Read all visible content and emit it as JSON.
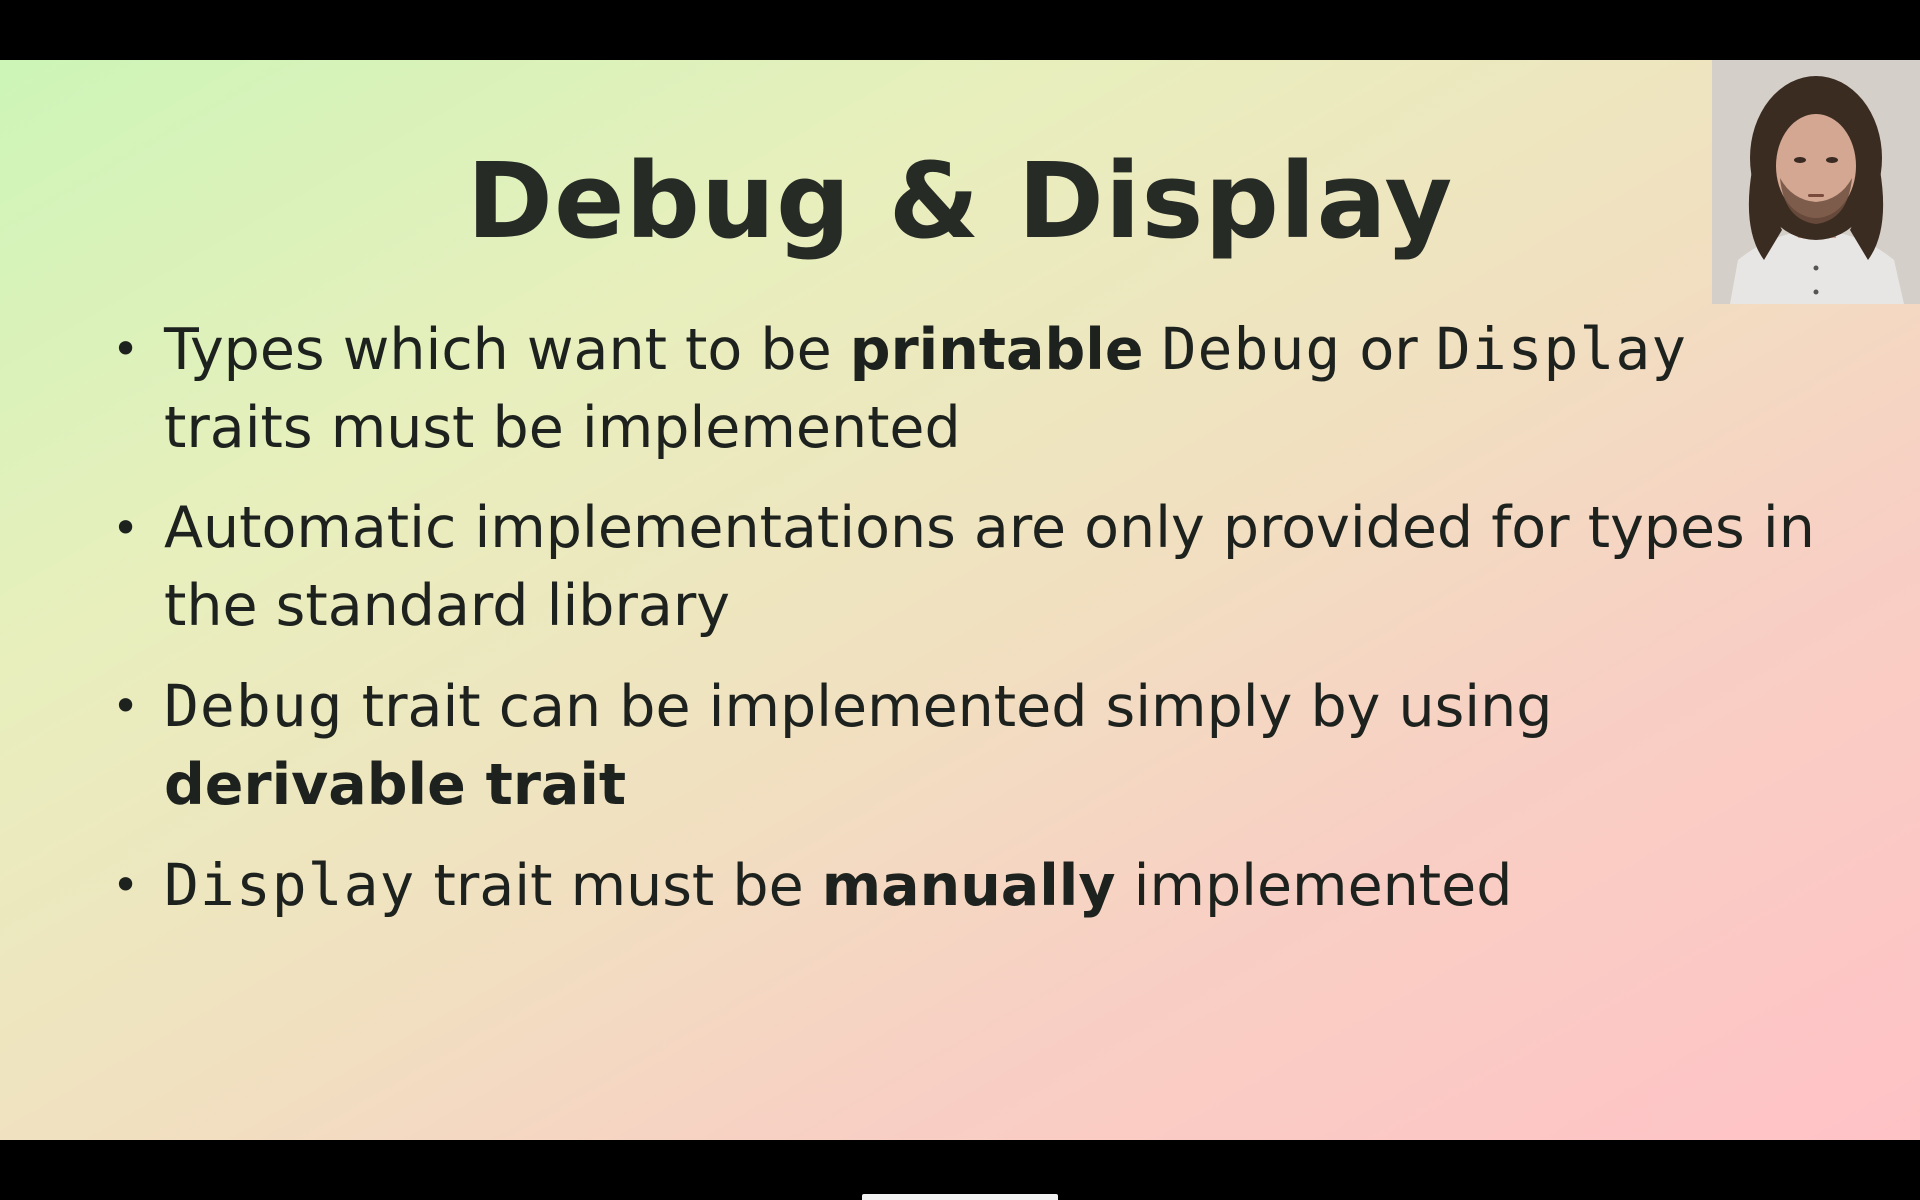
{
  "slide": {
    "title": "Debug & Display",
    "bullets": [
      {
        "segments": [
          {
            "text": "Types which want to be ",
            "style": "normal"
          },
          {
            "text": "printable",
            "style": "bold"
          },
          {
            "text": " ",
            "style": "normal"
          },
          {
            "text": "Debug",
            "style": "code"
          },
          {
            "text": " or ",
            "style": "normal"
          },
          {
            "text": "Display",
            "style": "code"
          },
          {
            "text": " traits must be implemented",
            "style": "normal"
          }
        ]
      },
      {
        "segments": [
          {
            "text": "Automatic implementations are only provided for types in the standard library",
            "style": "normal"
          }
        ]
      },
      {
        "segments": [
          {
            "text": "Debug",
            "style": "code"
          },
          {
            "text": " trait can be implemented simply by using ",
            "style": "normal"
          },
          {
            "text": "derivable trait",
            "style": "bold"
          }
        ]
      },
      {
        "segments": [
          {
            "text": "Display",
            "style": "code"
          },
          {
            "text": " trait must be ",
            "style": "normal"
          },
          {
            "text": "manually",
            "style": "bold"
          },
          {
            "text": " implemented",
            "style": "normal"
          }
        ]
      }
    ]
  },
  "webcam": {
    "icon": "presenter-webcam-feed"
  },
  "colors": {
    "background_start": "#cdf5b8",
    "background_end": "#ffc2c6",
    "text": "#1e221e",
    "letterbox": "#000000"
  }
}
